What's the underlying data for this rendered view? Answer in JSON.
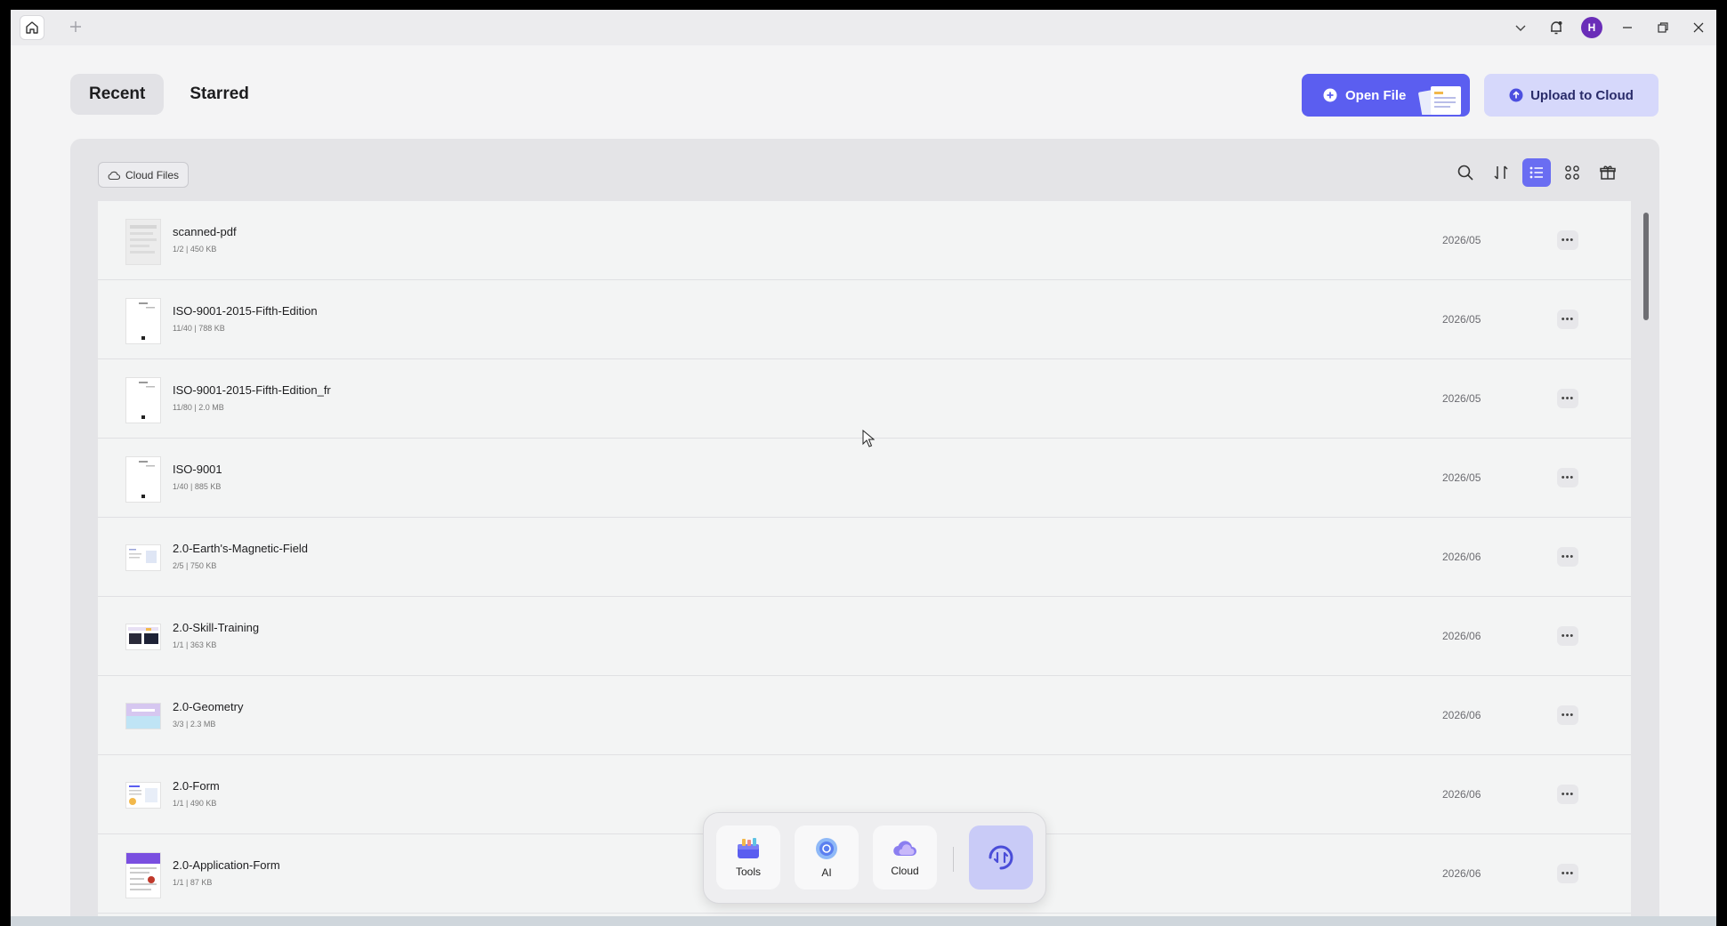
{
  "titlebar": {
    "avatar_letter": "H"
  },
  "header": {
    "tabs": [
      {
        "label": "Recent",
        "active": true
      },
      {
        "label": "Starred",
        "active": false
      }
    ],
    "open_file_label": "Open File",
    "upload_label": "Upload to Cloud"
  },
  "panel": {
    "cloud_chip_label": "Cloud Files"
  },
  "files": [
    {
      "name": "scanned-pdf",
      "meta": "1/2 | 450 KB",
      "date": "2026/05",
      "thumb": "gray-doc"
    },
    {
      "name": "ISO-9001-2015-Fifth-Edition",
      "meta": "11/40 | 788 KB",
      "date": "2026/05",
      "thumb": "white-doc"
    },
    {
      "name": "ISO-9001-2015-Fifth-Edition_fr",
      "meta": "11/80 | 2.0 MB",
      "date": "2026/05",
      "thumb": "white-doc"
    },
    {
      "name": "ISO-9001",
      "meta": "1/40 | 885 KB",
      "date": "2026/05",
      "thumb": "white-doc"
    },
    {
      "name": "2.0-Earth's-Magnetic-Field",
      "meta": "2/5 | 750 KB",
      "date": "2026/06",
      "thumb": "landscape-light"
    },
    {
      "name": "2.0-Skill-Training",
      "meta": "1/1 | 363 KB",
      "date": "2026/06",
      "thumb": "landscape-dark"
    },
    {
      "name": "2.0-Geometry",
      "meta": "3/3 | 2.3 MB",
      "date": "2026/06",
      "thumb": "landscape-pastel"
    },
    {
      "name": "2.0-Form",
      "meta": "1/1 | 490 KB",
      "date": "2026/06",
      "thumb": "landscape-form"
    },
    {
      "name": "2.0-Application-Form",
      "meta": "1/1 | 87 KB",
      "date": "2026/06",
      "thumb": "portrait-purple"
    }
  ],
  "dock": {
    "tools_label": "Tools",
    "ai_label": "AI",
    "cloud_label": "Cloud"
  },
  "colors": {
    "accent": "#5b5ef0",
    "upload_bg": "#d6d8fb",
    "avatar": "#6a2db8"
  }
}
